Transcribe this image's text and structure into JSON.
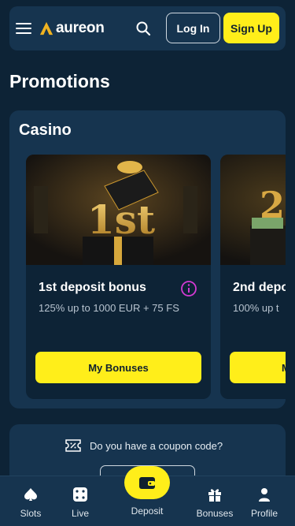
{
  "header": {
    "brand": "aureon",
    "login_label": "Log In",
    "signup_label": "Sign Up"
  },
  "page": {
    "title": "Promotions"
  },
  "casino": {
    "title": "Casino",
    "cards": [
      {
        "title": "1st deposit bonus",
        "subtitle": "125% up to 1000 EUR + 75 FS",
        "button": "My Bonuses",
        "image_badge": "1st"
      },
      {
        "title": "2nd depo",
        "subtitle": "100% up t",
        "button": "M",
        "image_badge": "2"
      }
    ]
  },
  "coupon": {
    "question": "Do you have a coupon code?"
  },
  "nav": {
    "items": [
      {
        "label": "Slots",
        "icon": "spade-icon"
      },
      {
        "label": "Live",
        "icon": "dice-icon"
      },
      {
        "label": "Deposit",
        "icon": "wallet-icon"
      },
      {
        "label": "Bonuses",
        "icon": "gift-icon"
      },
      {
        "label": "Profile",
        "icon": "person-icon"
      }
    ]
  },
  "colors": {
    "background": "#0d2336",
    "panel": "#16344f",
    "accent": "#ffee1a",
    "info": "#d33ad3"
  }
}
